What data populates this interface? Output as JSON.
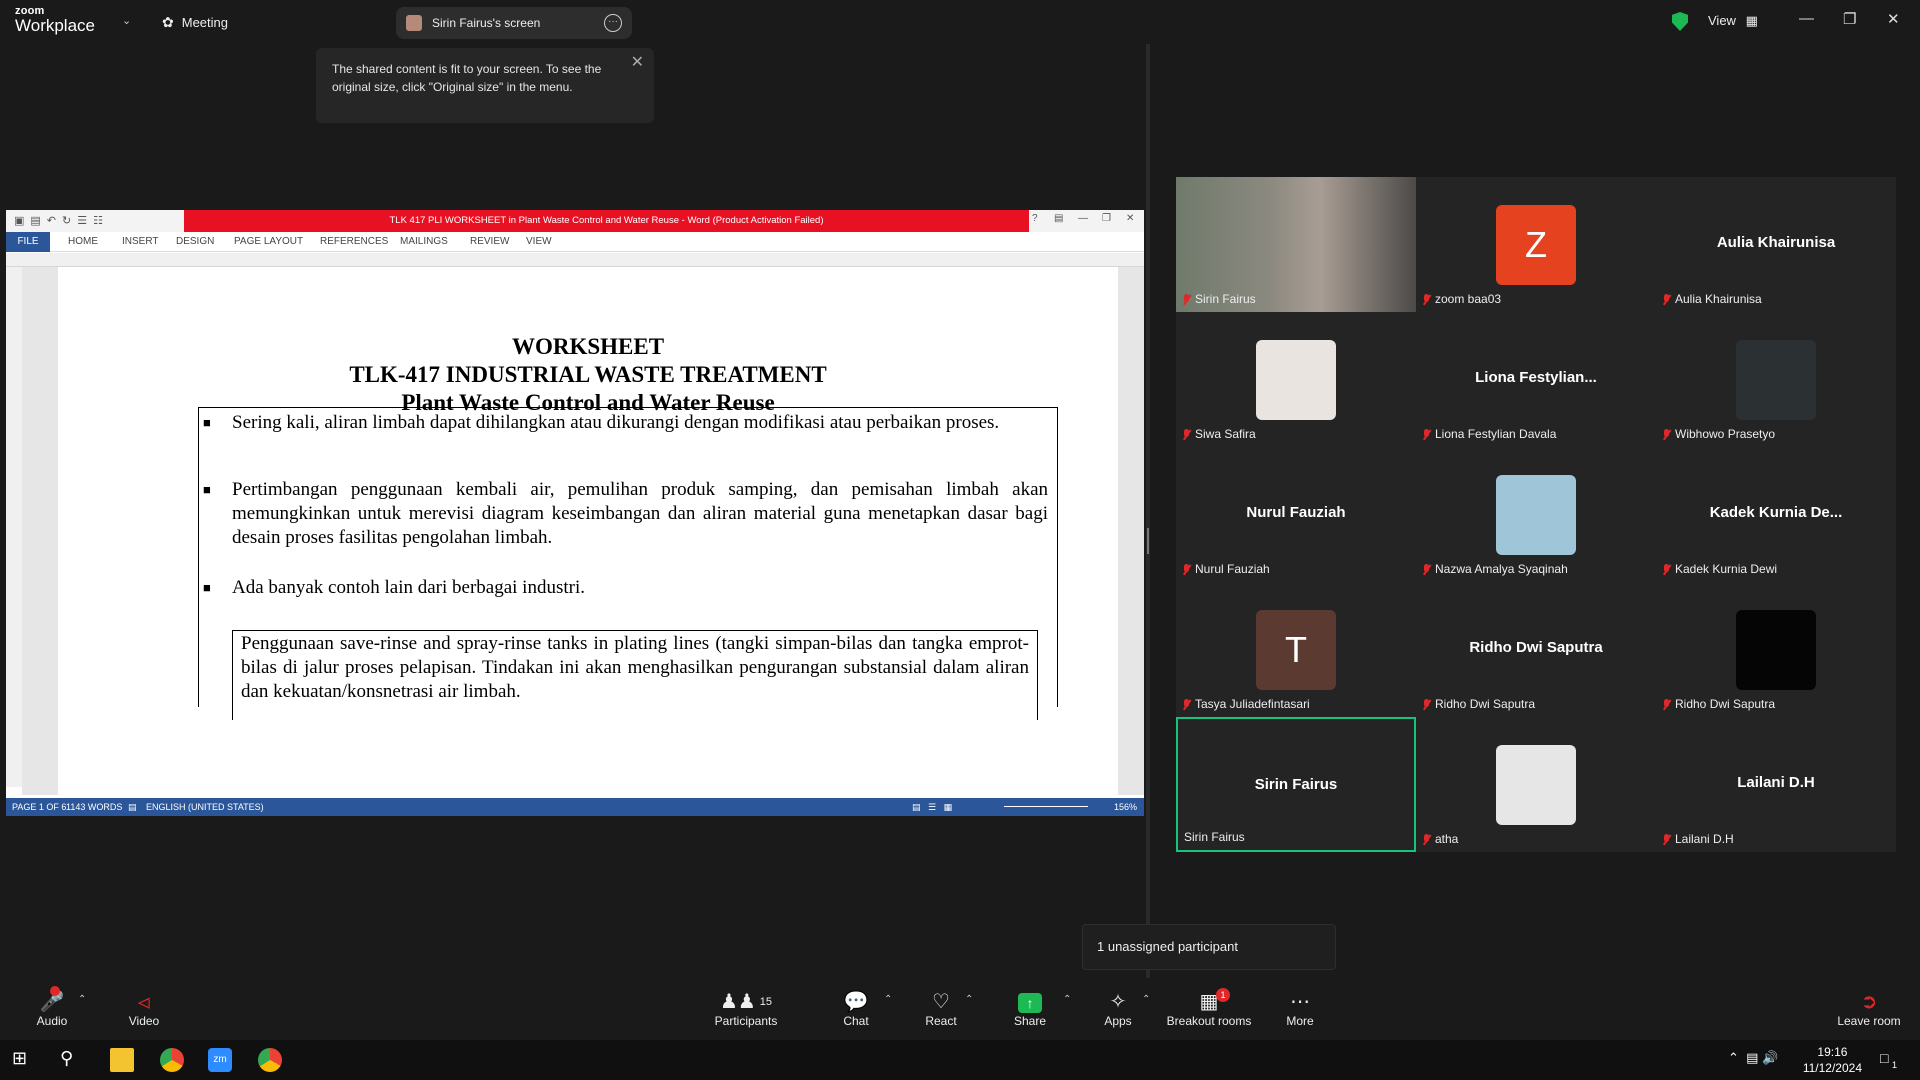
{
  "app": {
    "brand_top": "zoom",
    "brand_bottom": "Workplace",
    "meeting_label": "Meeting",
    "screen_pill": "Sirin Fairus's screen",
    "view_label": "View"
  },
  "tooltip": {
    "text": "The shared content is fit to your screen. To see the original size, click \"Original size\" in the menu."
  },
  "word": {
    "title": "TLK 417 PLI WORKSHEET in Plant Waste Control and Water Reuse - Word (Product Activation Failed)",
    "tabs": [
      "FILE",
      "HOME",
      "INSERT",
      "DESIGN",
      "PAGE LAYOUT",
      "REFERENCES",
      "MAILINGS",
      "REVIEW",
      "VIEW"
    ],
    "status": {
      "page": "PAGE 1 OF 6",
      "words": "1143 WORDS",
      "lang": "ENGLISH (UNITED STATES)",
      "zoom": "156%"
    },
    "doc": {
      "title1": "WORKSHEET",
      "title2": "TLK-417  INDUSTRIAL WASTE TREATMENT",
      "title3": "Plant Waste Control and Water Reuse",
      "bullet1": "Sering kali, aliran limbah dapat dihilangkan atau dikurangi dengan modifikasi atau perbaikan proses.",
      "bullet2": "Pertimbangan penggunaan kembali air, pemulihan produk samping, dan pemisahan limbah akan memungkinkan untuk merevisi diagram keseimbangan dan aliran material guna menetapkan dasar bagi desain proses fasilitas pengolahan limbah.",
      "bullet3": "Ada banyak contoh lain dari berbagai industri.",
      "box": "Penggunaan save-rinse and spray-rinse tanks in plating lines (tangki simpan-bilas dan tangka emprot-bilas di jalur proses pelapisan. Tindakan ini akan menghasilkan pengurangan substansial dalam aliran dan kekuatan/konsnetrasi air limbah."
    }
  },
  "participants": [
    {
      "name": "Sirin Fairus",
      "display": "",
      "type": "video",
      "muted": true
    },
    {
      "name": "zoom baa03",
      "display": "Z",
      "type": "letter",
      "color": "#e5431f",
      "muted": true
    },
    {
      "name": "Aulia Khairunisa",
      "display": "Aulia Khairunisa",
      "type": "name",
      "muted": true
    },
    {
      "name": "Siwa Safira",
      "display": "",
      "type": "photo",
      "color": "#e9e4e0",
      "muted": true
    },
    {
      "name": "Liona Festylian Davala",
      "display": "Liona  Festylian...",
      "type": "name",
      "muted": true
    },
    {
      "name": "Wibhowo Prasetyo",
      "display": "",
      "type": "photo",
      "color": "#2b3033",
      "muted": true
    },
    {
      "name": "Nurul Fauziah",
      "display": "Nurul Fauziah",
      "type": "name",
      "muted": true
    },
    {
      "name": "Nazwa Amalya Syaqinah",
      "display": "",
      "type": "photo",
      "color": "#9ec6d8",
      "muted": true
    },
    {
      "name": "Kadek Kurnia Dewi",
      "display": "Kadek Kurnia De...",
      "type": "name",
      "muted": true
    },
    {
      "name": "Tasya Juliadefintasari",
      "display": "T",
      "type": "letter",
      "color": "#5b3a32",
      "muted": true
    },
    {
      "name": "Ridho Dwi Saputra",
      "display": "Ridho Dwi Saputra",
      "type": "name",
      "muted": true
    },
    {
      "name": "Ridho Dwi Saputra",
      "display": "",
      "type": "photo",
      "color": "#050505",
      "muted": true
    },
    {
      "name": "Sirin Fairus",
      "display": "Sirin Fairus",
      "type": "name",
      "muted": false,
      "active": true
    },
    {
      "name": "atha",
      "display": "",
      "type": "photo",
      "color": "#e6e6e6",
      "muted": true
    },
    {
      "name": "Lailani D.H",
      "display": "Lailani D.H",
      "type": "name",
      "muted": true
    }
  ],
  "unassigned": "1 unassigned participant",
  "toolbar": {
    "audio": "Audio",
    "video": "Video",
    "participants": "Participants",
    "participants_count": "15",
    "chat": "Chat",
    "react": "React",
    "share": "Share",
    "apps": "Apps",
    "breakout": "Breakout rooms",
    "breakout_badge": "1",
    "more": "More",
    "leave": "Leave room"
  },
  "taskbar": {
    "time": "19:16",
    "date": "11/12/2024",
    "notif": "1"
  }
}
